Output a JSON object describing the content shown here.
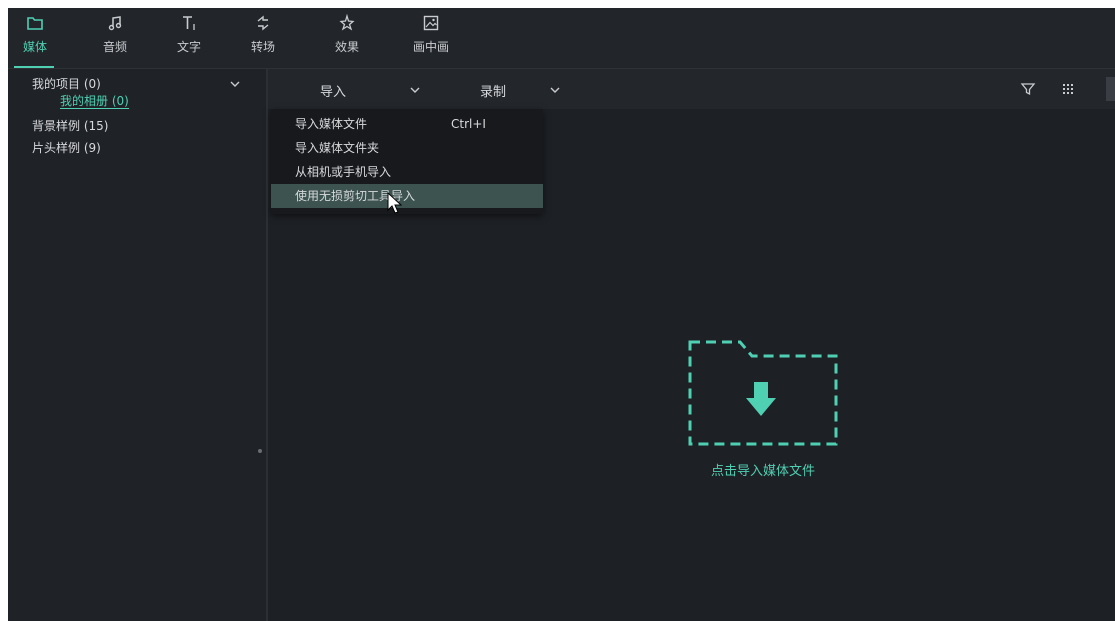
{
  "toolbar": {
    "items": [
      {
        "label": "媒体",
        "icon": "folder-icon",
        "active": true
      },
      {
        "label": "音频",
        "icon": "music-note-icon"
      },
      {
        "label": "文字",
        "icon": "text-icon"
      },
      {
        "label": "转场",
        "icon": "transition-icon"
      },
      {
        "label": "效果",
        "icon": "effects-icon"
      },
      {
        "label": "画中画",
        "icon": "picture-in-picture-icon"
      }
    ]
  },
  "sidebar": {
    "project": "我的项目 (0)",
    "album": "我的相册 (0)",
    "background_samples": "背景样例 (15)",
    "intro_samples": "片头样例 (9)"
  },
  "main_toolbar": {
    "import_label": "导入",
    "record_label": "录制",
    "filter_icon": "filter-icon",
    "grid_icon": "grid-view-icon"
  },
  "import_menu": {
    "items": [
      {
        "label": "导入媒体文件",
        "shortcut": "Ctrl+I"
      },
      {
        "label": "导入媒体文件夹"
      },
      {
        "label": "从相机或手机导入"
      },
      {
        "label": "使用无损剪切工具导入",
        "highlighted": true
      }
    ]
  },
  "empty_state": {
    "label": "点击导入媒体文件"
  },
  "colors": {
    "accent": "#4fd0b2",
    "background": "#1d2025",
    "menu_highlight": "#3c5350"
  }
}
